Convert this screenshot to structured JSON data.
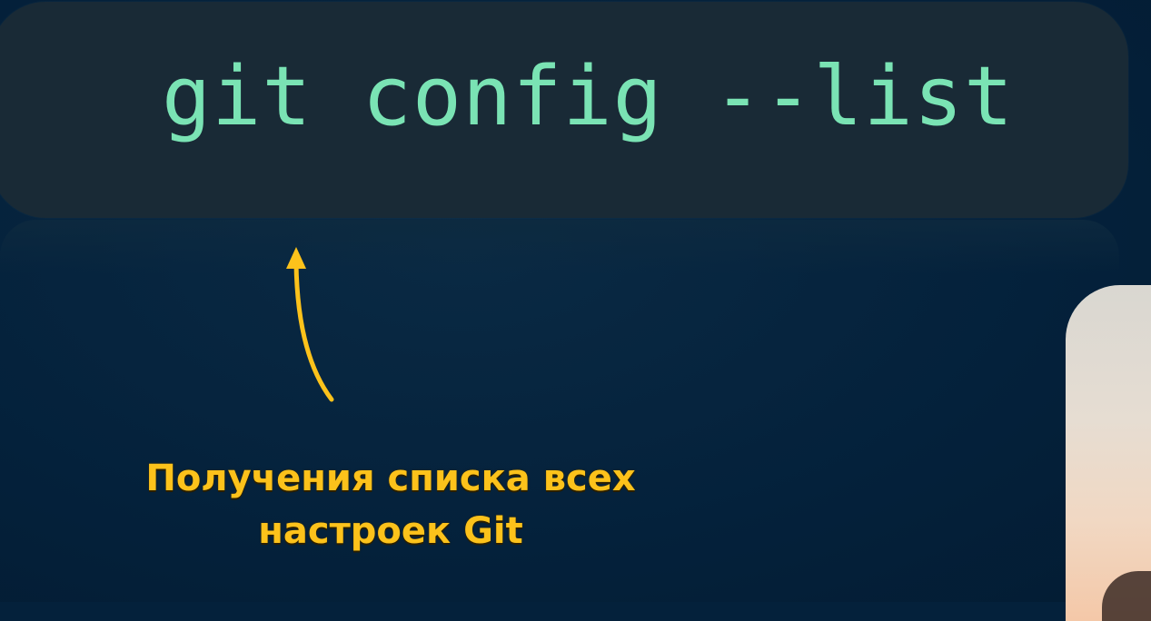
{
  "command": {
    "text": "git config --list"
  },
  "caption": {
    "line1": "Получения списка всех",
    "line2": "настроек Git"
  },
  "colors": {
    "background": "#04213b",
    "code_card": "#192a36",
    "code_text": "#7ae3b4",
    "caption": "#fcc21b",
    "arrow": "#fcc21b"
  }
}
